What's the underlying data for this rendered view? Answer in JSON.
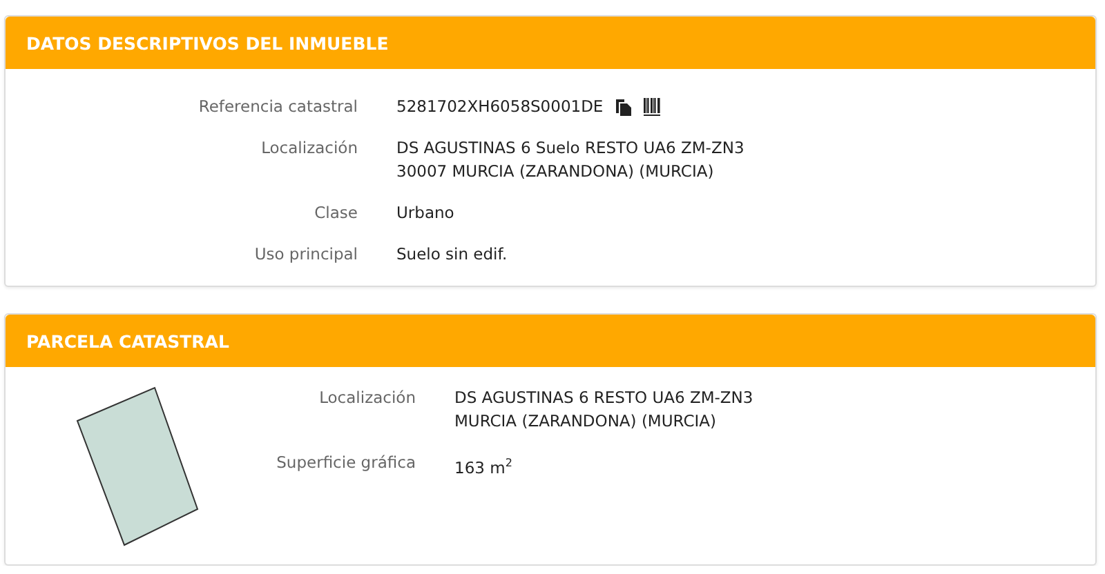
{
  "sections": [
    {
      "title": "DATOS DESCRIPTIVOS DEL INMUEBLE",
      "kind": "details",
      "rows": [
        {
          "label": "Referencia catastral",
          "lines": [
            "5281702XH6058S0001DE"
          ],
          "kind": "reference"
        },
        {
          "label": "Localización",
          "lines": [
            "DS AGUSTINAS 6 Suelo RESTO UA6 ZM-ZN3",
            "30007 MURCIA (ZARANDONA) (MURCIA)"
          ],
          "kind": "text"
        },
        {
          "label": "Clase",
          "lines": [
            "Urbano"
          ],
          "kind": "text"
        },
        {
          "label": "Uso principal",
          "lines": [
            "Suelo sin edif."
          ],
          "kind": "text"
        }
      ]
    },
    {
      "title": "PARCELA CATASTRAL",
      "kind": "parcel",
      "rows": [
        {
          "label": "Localización",
          "lines": [
            "DS AGUSTINAS 6 RESTO UA6 ZM-ZN3",
            "MURCIA (ZARANDONA) (MURCIA)"
          ],
          "kind": "text"
        },
        {
          "label": "Superficie gráfica",
          "lines": [
            "163 m$^{2}$"
          ],
          "kind": "text"
        }
      ]
    }
  ]
}
